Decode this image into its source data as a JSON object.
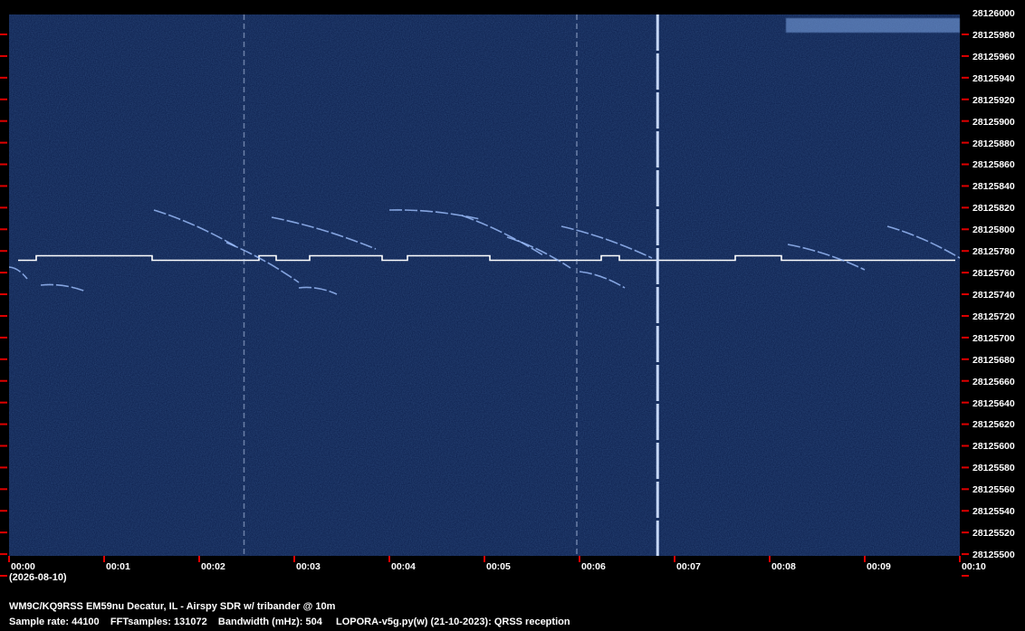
{
  "chart_data": {
    "type": "heatmap",
    "ylim": [
      28125500,
      28126000
    ],
    "xlim_minutes": [
      0,
      10
    ],
    "y_ticks": [
      "28126000",
      "28125980",
      "28125960",
      "28125940",
      "28125920",
      "28125900",
      "28125880",
      "28125860",
      "28125840",
      "28125820",
      "28125800",
      "28125780",
      "28125760",
      "28125740",
      "28125720",
      "28125700",
      "28125680",
      "28125660",
      "28125640",
      "28125620",
      "28125600",
      "28125580",
      "28125560",
      "28125540",
      "28125520",
      "28125500"
    ],
    "x_ticks": [
      "00:00",
      "00:01",
      "00:02",
      "00:03",
      "00:04",
      "00:05",
      "00:06",
      "00:07",
      "00:08",
      "00:09",
      "00:10"
    ],
    "date_label": "(2026-08-10)",
    "station_line": "WM9C/KQ9RSS EM59nu Decatur, IL - Airspy SDR w/ tribander @ 10m",
    "params_line_left": "Sample rate: 44100    FFTsamples: 131072    Bandwidth (mHz): 504",
    "params_line_right": "LOPORA-v5g.py(w) (21-10-2023): QRSS reception",
    "signals": {
      "carrier_hz": 28125773,
      "vertical_bursts_min": [
        2.5,
        6.0,
        6.85
      ]
    },
    "colors": {
      "background": "#0d2152",
      "signal": "#ffffff",
      "tick": "#e00000",
      "text": "#ffffff"
    }
  }
}
